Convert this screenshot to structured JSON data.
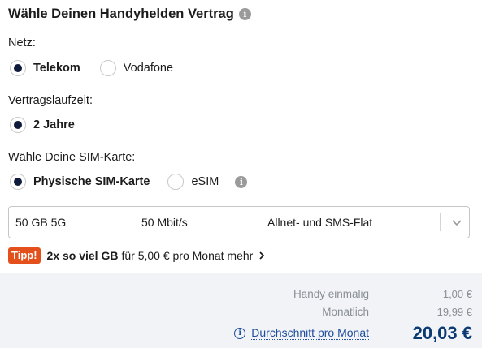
{
  "heading": {
    "title": "Wähle Deinen Handyhelden Vertrag",
    "info_icon": "info-icon"
  },
  "network": {
    "label": "Netz:",
    "options": [
      {
        "label": "Telekom",
        "selected": true
      },
      {
        "label": "Vodafone",
        "selected": false
      }
    ]
  },
  "term": {
    "label": "Vertragslaufzeit:",
    "options": [
      {
        "label": "2 Jahre",
        "selected": true
      }
    ]
  },
  "sim": {
    "label": "Wähle Deine SIM-Karte:",
    "options": [
      {
        "label": "Physische SIM-Karte",
        "selected": true
      },
      {
        "label": "eSIM",
        "selected": false
      }
    ],
    "info_icon": "info-icon"
  },
  "tariff_select": {
    "data_volume": "50 GB 5G",
    "speed": "50 Mbit/s",
    "flat": "Allnet- und SMS-Flat",
    "icon": "chevron-down-icon"
  },
  "tip": {
    "badge": "Tipp!",
    "highlight": "2x so viel GB",
    "text": "für 5,00 € pro Monat mehr",
    "icon": "chevron-right-icon",
    "badge_color": "#e3501b"
  },
  "summary": {
    "rows": [
      {
        "label": "Handy einmalig",
        "value": "1,00 €"
      },
      {
        "label": "Monatlich",
        "value": "19,99 €"
      }
    ],
    "average_label": "Durchschnitt pro Monat",
    "average_value": "20,03 €",
    "accent_color": "#0b3a73"
  }
}
